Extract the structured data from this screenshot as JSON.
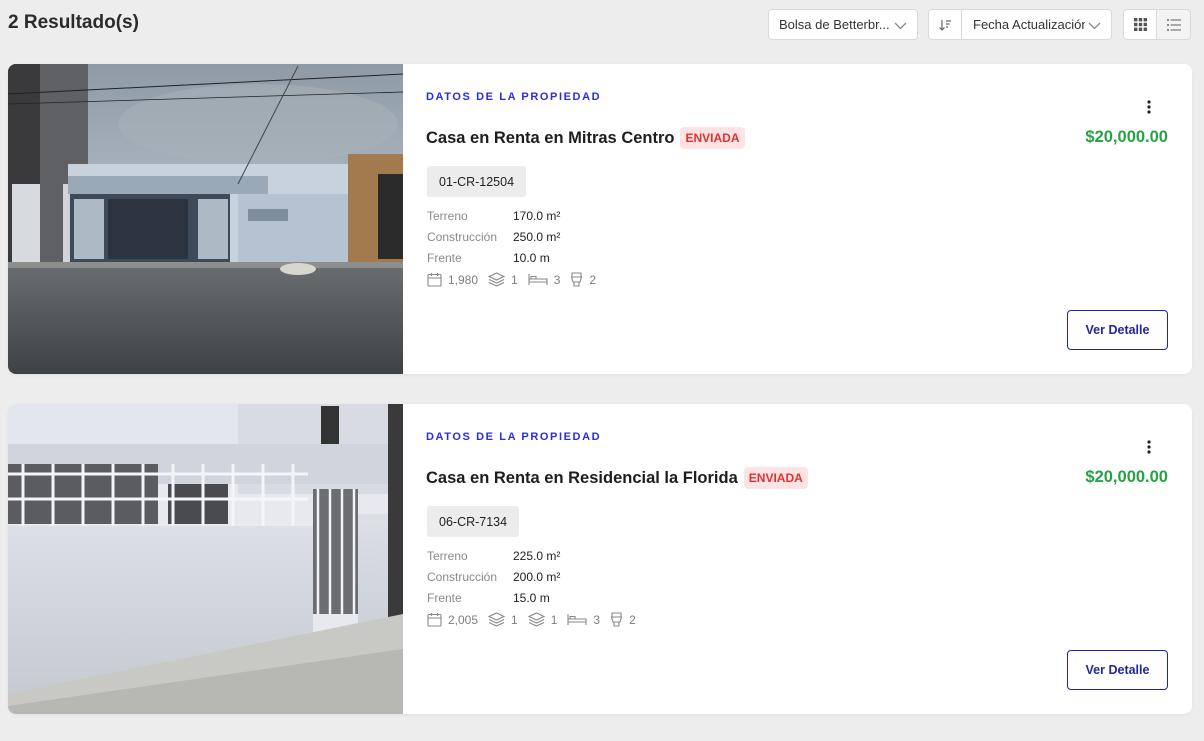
{
  "header": {
    "results_count": "2 Resultado(s)",
    "bolsa_select": "Bolsa de Betterbr...",
    "sort_select": "Fecha Actualización",
    "sort_icon": "sort-desc-icon",
    "view_grid_icon": "grid-view-icon",
    "view_list_icon": "list-view-icon"
  },
  "listings": [
    {
      "section_label": "DATOS DE LA PROPIEDAD",
      "title": "Casa en Renta en Mitras Centro",
      "status": "ENVIADA",
      "price": "$20,000.00",
      "code": "01-CR-12504",
      "specs": [
        {
          "label": "Terreno",
          "value": "170.0 m²"
        },
        {
          "label": "Construcción",
          "value": "250.0 m²"
        },
        {
          "label": "Frente",
          "value": "10.0 m"
        }
      ],
      "amenities": {
        "year": "1,980",
        "floors": "1",
        "bedrooms": "3",
        "bathrooms": "2"
      },
      "detail_button": "Ver Detalle"
    },
    {
      "section_label": "DATOS DE LA PROPIEDAD",
      "title": "Casa en Renta en Residencial la Florida",
      "status": "ENVIADA",
      "price": "$20,000.00",
      "code": "06-CR-7134",
      "specs": [
        {
          "label": "Terreno",
          "value": "225.0 m²"
        },
        {
          "label": "Construcción",
          "value": "200.0 m²"
        },
        {
          "label": "Frente",
          "value": "15.0 m"
        }
      ],
      "amenities": {
        "year": "2,005",
        "floors": "1",
        "floors2": "1",
        "bedrooms": "3",
        "bathrooms": "2"
      },
      "detail_button": "Ver Detalle"
    }
  ],
  "colors": {
    "accent": "#2c2ce0",
    "price": "#25a244",
    "badge_bg": "#fde3e3",
    "badge_text": "#e0312f",
    "button": "#24249e"
  }
}
